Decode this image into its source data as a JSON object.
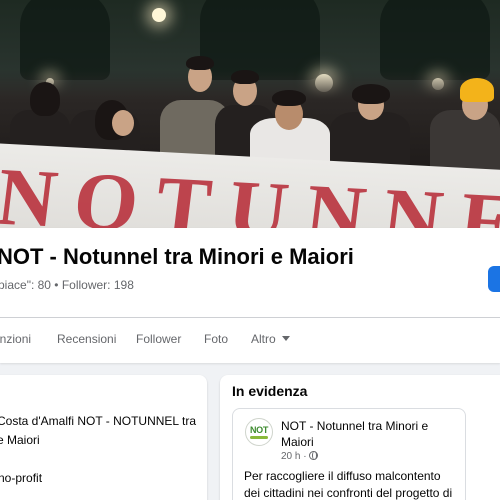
{
  "cover": {
    "banner_text": "NOTUNNEL"
  },
  "page": {
    "name": "NOT - Notunnel tra Minori e Maiori",
    "stats": "piace\": 80 • Follower: 198"
  },
  "tabs": [
    {
      "label": "enzioni"
    },
    {
      "label": "Recensioni"
    },
    {
      "label": "Follower"
    },
    {
      "label": "Foto"
    },
    {
      "label": "Altro"
    }
  ],
  "intro": {
    "text": "Costa d'Amalfi NOT - NOTUNNEL tra e Maiori",
    "category": "no-profit"
  },
  "featured": {
    "title": "In evidenza",
    "post": {
      "avatar_text": "NOT",
      "author": "NOT - Notunnel tra Minori e Maiori",
      "time": "20 h ·",
      "text": "Per raccogliere il diffuso malcontento dei cittadini nei confronti del progetto di"
    }
  },
  "colors": {
    "accent": "#1b74e4",
    "banner_red": "#b8323d",
    "secondary_text": "#65676b"
  }
}
